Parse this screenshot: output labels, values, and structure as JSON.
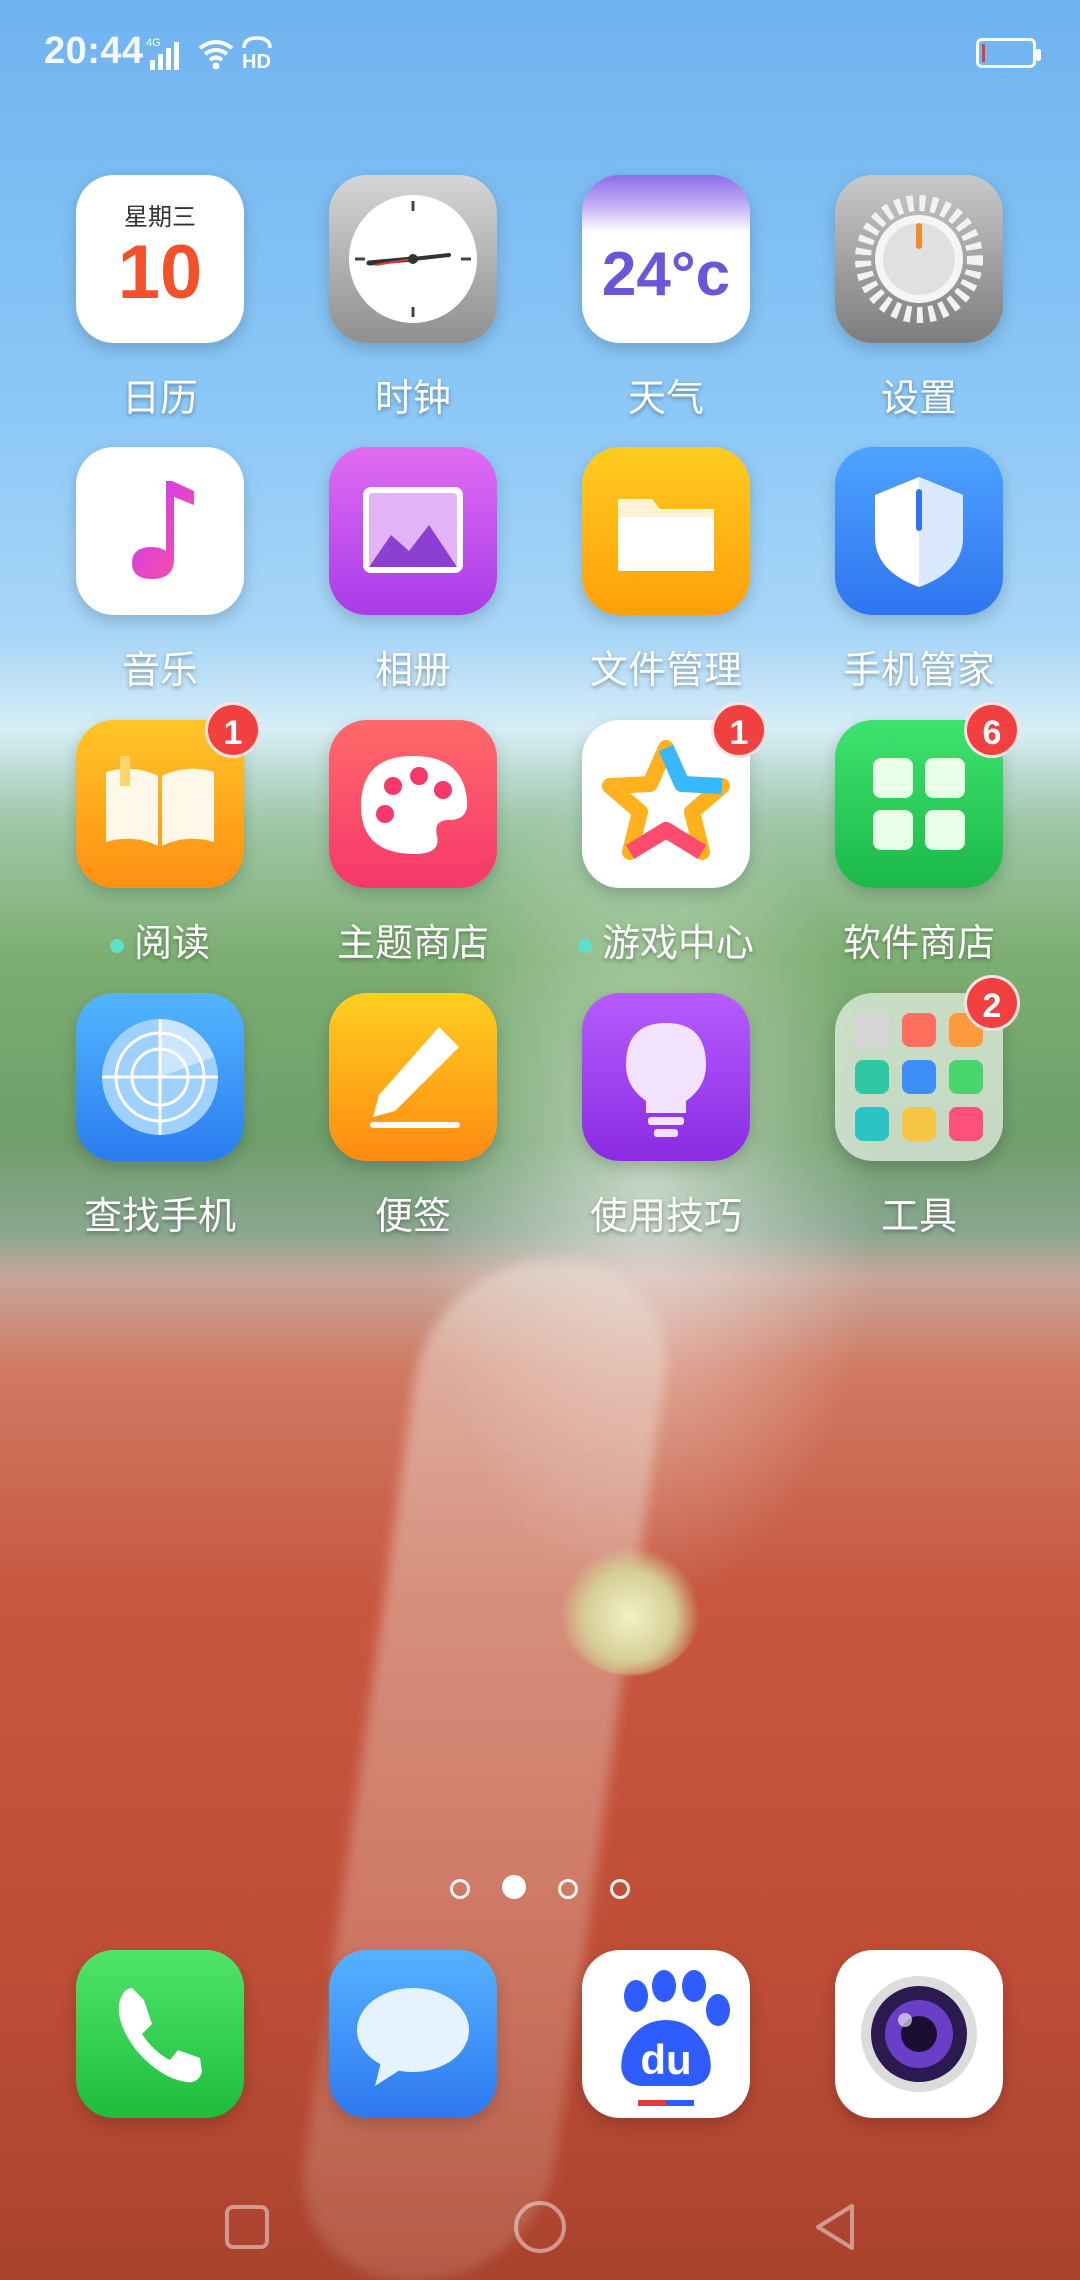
{
  "status_bar": {
    "time": "20:44",
    "network_label": "4G",
    "hd_label": "HD",
    "battery_level_fraction": 0.05
  },
  "apps": [
    {
      "label": "日历",
      "calendar_weekday": "星期三",
      "calendar_day": "10",
      "badge": null,
      "dot": false
    },
    {
      "label": "时钟",
      "badge": null,
      "dot": false
    },
    {
      "label": "天气",
      "temperature": "24°c",
      "badge": null,
      "dot": false
    },
    {
      "label": "设置",
      "badge": null,
      "dot": false
    },
    {
      "label": "音乐",
      "badge": null,
      "dot": false
    },
    {
      "label": "相册",
      "badge": null,
      "dot": false
    },
    {
      "label": "文件管理",
      "badge": null,
      "dot": false
    },
    {
      "label": "手机管家",
      "badge": null,
      "dot": false
    },
    {
      "label": "阅读",
      "badge": "1",
      "dot": true
    },
    {
      "label": "主题商店",
      "badge": null,
      "dot": false
    },
    {
      "label": "游戏中心",
      "badge": "1",
      "dot": true
    },
    {
      "label": "软件商店",
      "badge": "6",
      "dot": false
    },
    {
      "label": "查找手机",
      "badge": null,
      "dot": false
    },
    {
      "label": "便签",
      "badge": null,
      "dot": false
    },
    {
      "label": "使用技巧",
      "badge": null,
      "dot": false
    },
    {
      "label": "工具",
      "badge": "2",
      "dot": false
    }
  ],
  "pager": {
    "pages": 4,
    "active": 1
  },
  "dock": [
    {
      "name": "phone"
    },
    {
      "name": "messages"
    },
    {
      "name": "baidu",
      "text": "du"
    },
    {
      "name": "camera"
    }
  ],
  "icons": {
    "calendar": "calendar-icon",
    "clock": "clock-icon",
    "weather": "weather-icon",
    "settings": "gear-icon",
    "music": "music-note-icon",
    "gallery": "gallery-icon",
    "files": "folder-icon",
    "phone_manager": "shield-icon",
    "reader": "book-icon",
    "theme_store": "palette-icon",
    "game_center": "star-icon",
    "app_store": "app-grid-icon",
    "find_phone": "radar-icon",
    "notes": "pencil-icon",
    "tips": "lightbulb-icon",
    "tools": "folder-apps-icon"
  },
  "colors": {
    "badge": "#f04040",
    "dot": "#5de0c8"
  }
}
